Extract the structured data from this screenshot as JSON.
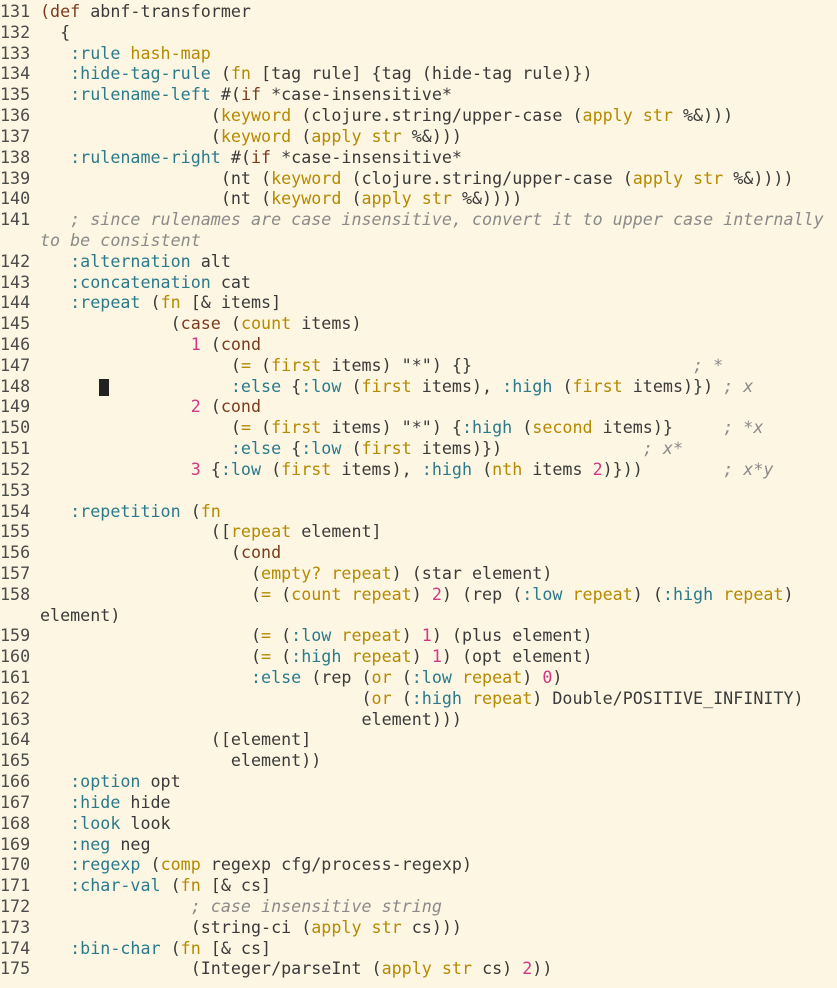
{
  "editor": {
    "lines": [
      {
        "n": "131",
        "t": [
          [
            "d",
            "(def "
          ],
          [
            "p",
            "abnf-transformer"
          ]
        ]
      },
      {
        "n": "132",
        "t": [
          [
            "p",
            "  {"
          ]
        ]
      },
      {
        "n": "133",
        "t": [
          [
            "p",
            "   "
          ],
          [
            "k",
            ":rule "
          ],
          [
            "f",
            "hash-map"
          ]
        ]
      },
      {
        "n": "134",
        "t": [
          [
            "p",
            "   "
          ],
          [
            "k",
            ":hide-tag-rule "
          ],
          [
            "p",
            "("
          ],
          [
            "f",
            "fn "
          ],
          [
            "p",
            "[tag rule] {tag (hide-tag rule)})"
          ]
        ]
      },
      {
        "n": "135",
        "t": [
          [
            "p",
            "   "
          ],
          [
            "k",
            ":rulename-left "
          ],
          [
            "p",
            "#("
          ],
          [
            "d",
            "if "
          ],
          [
            "p",
            "*case-insensitive*"
          ]
        ]
      },
      {
        "n": "136",
        "t": [
          [
            "p",
            "                 ("
          ],
          [
            "f",
            "keyword "
          ],
          [
            "p",
            "(clojure.string/upper-case ("
          ],
          [
            "f",
            "apply str "
          ],
          [
            "p",
            "%&)))"
          ]
        ]
      },
      {
        "n": "137",
        "t": [
          [
            "p",
            "                 ("
          ],
          [
            "f",
            "keyword "
          ],
          [
            "p",
            "("
          ],
          [
            "f",
            "apply str "
          ],
          [
            "p",
            "%&)))"
          ]
        ]
      },
      {
        "n": "138",
        "t": [
          [
            "p",
            "   "
          ],
          [
            "k",
            ":rulename-right "
          ],
          [
            "p",
            "#("
          ],
          [
            "d",
            "if "
          ],
          [
            "p",
            "*case-insensitive*"
          ]
        ]
      },
      {
        "n": "139",
        "t": [
          [
            "p",
            "                  (nt ("
          ],
          [
            "f",
            "keyword "
          ],
          [
            "p",
            "(clojure.string/upper-case ("
          ],
          [
            "f",
            "apply str "
          ],
          [
            "p",
            "%&))))"
          ]
        ]
      },
      {
        "n": "140",
        "t": [
          [
            "p",
            "                  (nt ("
          ],
          [
            "f",
            "keyword "
          ],
          [
            "p",
            "("
          ],
          [
            "f",
            "apply str "
          ],
          [
            "p",
            "%&))))"
          ]
        ]
      },
      {
        "n": "141",
        "t": [
          [
            "c",
            "   ; since rulenames are case insensitive, convert it to upper case internally"
          ]
        ],
        "wrap": [
          [
            "c",
            "to be consistent"
          ]
        ]
      },
      {
        "n": "142",
        "t": [
          [
            "p",
            "   "
          ],
          [
            "k",
            ":alternation "
          ],
          [
            "p",
            "alt"
          ]
        ]
      },
      {
        "n": "143",
        "t": [
          [
            "p",
            "   "
          ],
          [
            "k",
            ":concatenation "
          ],
          [
            "p",
            "cat"
          ]
        ]
      },
      {
        "n": "144",
        "t": [
          [
            "p",
            "   "
          ],
          [
            "k",
            ":repeat "
          ],
          [
            "p",
            "("
          ],
          [
            "f",
            "fn "
          ],
          [
            "p",
            "[& items]"
          ]
        ]
      },
      {
        "n": "145",
        "t": [
          [
            "p",
            "             ("
          ],
          [
            "d",
            "case "
          ],
          [
            "p",
            "("
          ],
          [
            "f",
            "count "
          ],
          [
            "p",
            "items)"
          ]
        ]
      },
      {
        "n": "146",
        "t": [
          [
            "p",
            "               "
          ],
          [
            "n",
            "1 "
          ],
          [
            "p",
            "("
          ],
          [
            "d",
            "cond"
          ]
        ]
      },
      {
        "n": "147",
        "t": [
          [
            "p",
            "                   ("
          ],
          [
            "f",
            "= "
          ],
          [
            "p",
            "("
          ],
          [
            "f",
            "first "
          ],
          [
            "p",
            "items) \"*\") {}                      "
          ],
          [
            "c",
            "; *"
          ]
        ]
      },
      {
        "n": "148",
        "cursor": true,
        "t": [
          [
            "p",
            "                   "
          ],
          [
            "k",
            ":else "
          ],
          [
            "p",
            "{"
          ],
          [
            "k",
            ":low "
          ],
          [
            "p",
            "("
          ],
          [
            "f",
            "first "
          ],
          [
            "p",
            "items), "
          ],
          [
            "k",
            ":high "
          ],
          [
            "p",
            "("
          ],
          [
            "f",
            "first "
          ],
          [
            "p",
            "items)}) "
          ],
          [
            "c",
            "; x"
          ]
        ]
      },
      {
        "n": "149",
        "t": [
          [
            "p",
            "               "
          ],
          [
            "n",
            "2 "
          ],
          [
            "p",
            "("
          ],
          [
            "d",
            "cond"
          ]
        ]
      },
      {
        "n": "150",
        "t": [
          [
            "p",
            "                   ("
          ],
          [
            "f",
            "= "
          ],
          [
            "p",
            "("
          ],
          [
            "f",
            "first "
          ],
          [
            "p",
            "items) \"*\") {"
          ],
          [
            "k",
            ":high "
          ],
          [
            "p",
            "("
          ],
          [
            "f",
            "second "
          ],
          [
            "p",
            "items)}     "
          ],
          [
            "c",
            "; *x"
          ]
        ]
      },
      {
        "n": "151",
        "t": [
          [
            "p",
            "                   "
          ],
          [
            "k",
            ":else "
          ],
          [
            "p",
            "{"
          ],
          [
            "k",
            ":low "
          ],
          [
            "p",
            "("
          ],
          [
            "f",
            "first "
          ],
          [
            "p",
            "items)})              "
          ],
          [
            "c",
            "; x*"
          ]
        ]
      },
      {
        "n": "152",
        "t": [
          [
            "p",
            "               "
          ],
          [
            "n",
            "3 "
          ],
          [
            "p",
            "{"
          ],
          [
            "k",
            ":low "
          ],
          [
            "p",
            "("
          ],
          [
            "f",
            "first "
          ],
          [
            "p",
            "items), "
          ],
          [
            "k",
            ":high "
          ],
          [
            "p",
            "("
          ],
          [
            "f",
            "nth "
          ],
          [
            "p",
            "items "
          ],
          [
            "n",
            "2"
          ],
          [
            "p",
            ")}))        "
          ],
          [
            "c",
            "; x*y"
          ]
        ]
      },
      {
        "n": "153",
        "t": []
      },
      {
        "n": "154",
        "t": [
          [
            "p",
            "   "
          ],
          [
            "k",
            ":repetition "
          ],
          [
            "p",
            "("
          ],
          [
            "f",
            "fn"
          ]
        ]
      },
      {
        "n": "155",
        "t": [
          [
            "p",
            "                 (["
          ],
          [
            "f",
            "repeat "
          ],
          [
            "p",
            "element]"
          ]
        ]
      },
      {
        "n": "156",
        "t": [
          [
            "p",
            "                   ("
          ],
          [
            "d",
            "cond"
          ]
        ]
      },
      {
        "n": "157",
        "t": [
          [
            "p",
            "                     ("
          ],
          [
            "f",
            "empty? repeat"
          ],
          [
            "p",
            ") (star element)"
          ]
        ]
      },
      {
        "n": "158",
        "t": [
          [
            "p",
            "                     ("
          ],
          [
            "f",
            "= "
          ],
          [
            "p",
            "("
          ],
          [
            "f",
            "count repeat"
          ],
          [
            "p",
            ") "
          ],
          [
            "n",
            "2"
          ],
          [
            "p",
            ") (rep ("
          ],
          [
            "k",
            ":low "
          ],
          [
            "f",
            "repeat"
          ],
          [
            "p",
            ") ("
          ],
          [
            "k",
            ":high "
          ],
          [
            "f",
            "repeat"
          ],
          [
            "p",
            ")"
          ]
        ],
        "wrap": [
          [
            "p",
            "element)"
          ]
        ],
        "wrapLeft": true
      },
      {
        "n": "159",
        "t": [
          [
            "p",
            "                     ("
          ],
          [
            "f",
            "= "
          ],
          [
            "p",
            "("
          ],
          [
            "k",
            ":low "
          ],
          [
            "f",
            "repeat"
          ],
          [
            "p",
            ") "
          ],
          [
            "n",
            "1"
          ],
          [
            "p",
            ") (plus element)"
          ]
        ]
      },
      {
        "n": "160",
        "t": [
          [
            "p",
            "                     ("
          ],
          [
            "f",
            "= "
          ],
          [
            "p",
            "("
          ],
          [
            "k",
            ":high "
          ],
          [
            "f",
            "repeat"
          ],
          [
            "p",
            ") "
          ],
          [
            "n",
            "1"
          ],
          [
            "p",
            ") (opt element)"
          ]
        ]
      },
      {
        "n": "161",
        "t": [
          [
            "p",
            "                     "
          ],
          [
            "k",
            ":else "
          ],
          [
            "p",
            "(rep ("
          ],
          [
            "f",
            "or "
          ],
          [
            "p",
            "("
          ],
          [
            "k",
            ":low "
          ],
          [
            "f",
            "repeat"
          ],
          [
            "p",
            ") "
          ],
          [
            "n",
            "0"
          ],
          [
            "p",
            ")"
          ]
        ]
      },
      {
        "n": "162",
        "t": [
          [
            "p",
            "                                ("
          ],
          [
            "f",
            "or "
          ],
          [
            "p",
            "("
          ],
          [
            "k",
            ":high "
          ],
          [
            "f",
            "repeat"
          ],
          [
            "p",
            ") Double/POSITIVE_INFINITY)"
          ]
        ]
      },
      {
        "n": "163",
        "t": [
          [
            "p",
            "                                element)))"
          ]
        ]
      },
      {
        "n": "164",
        "t": [
          [
            "p",
            "                 ([element]"
          ]
        ]
      },
      {
        "n": "165",
        "t": [
          [
            "p",
            "                   element))"
          ]
        ]
      },
      {
        "n": "166",
        "t": [
          [
            "p",
            "   "
          ],
          [
            "k",
            ":option "
          ],
          [
            "p",
            "opt"
          ]
        ]
      },
      {
        "n": "167",
        "t": [
          [
            "p",
            "   "
          ],
          [
            "k",
            ":hide "
          ],
          [
            "p",
            "hide"
          ]
        ]
      },
      {
        "n": "168",
        "t": [
          [
            "p",
            "   "
          ],
          [
            "k",
            ":look "
          ],
          [
            "p",
            "look"
          ]
        ]
      },
      {
        "n": "169",
        "t": [
          [
            "p",
            "   "
          ],
          [
            "k",
            ":neg "
          ],
          [
            "p",
            "neg"
          ]
        ]
      },
      {
        "n": "170",
        "t": [
          [
            "p",
            "   "
          ],
          [
            "k",
            ":regexp "
          ],
          [
            "p",
            "("
          ],
          [
            "f",
            "comp "
          ],
          [
            "p",
            "regexp cfg/process-regexp)"
          ]
        ]
      },
      {
        "n": "171",
        "t": [
          [
            "p",
            "   "
          ],
          [
            "k",
            ":char-val "
          ],
          [
            "p",
            "("
          ],
          [
            "f",
            "fn "
          ],
          [
            "p",
            "[& cs]"
          ]
        ]
      },
      {
        "n": "172",
        "t": [
          [
            "c",
            "               ; case insensitive string"
          ]
        ]
      },
      {
        "n": "173",
        "t": [
          [
            "p",
            "               (string-ci ("
          ],
          [
            "f",
            "apply str "
          ],
          [
            "p",
            "cs)))"
          ]
        ]
      },
      {
        "n": "174",
        "t": [
          [
            "p",
            "   "
          ],
          [
            "k",
            ":bin-char "
          ],
          [
            "p",
            "("
          ],
          [
            "f",
            "fn "
          ],
          [
            "p",
            "[& cs]"
          ]
        ]
      },
      {
        "n": "175",
        "t": [
          [
            "p",
            "               (Integer/parseInt ("
          ],
          [
            "f",
            "apply str "
          ],
          [
            "p",
            "cs) "
          ],
          [
            "n",
            "2"
          ],
          [
            "p",
            "))"
          ]
        ]
      }
    ]
  }
}
